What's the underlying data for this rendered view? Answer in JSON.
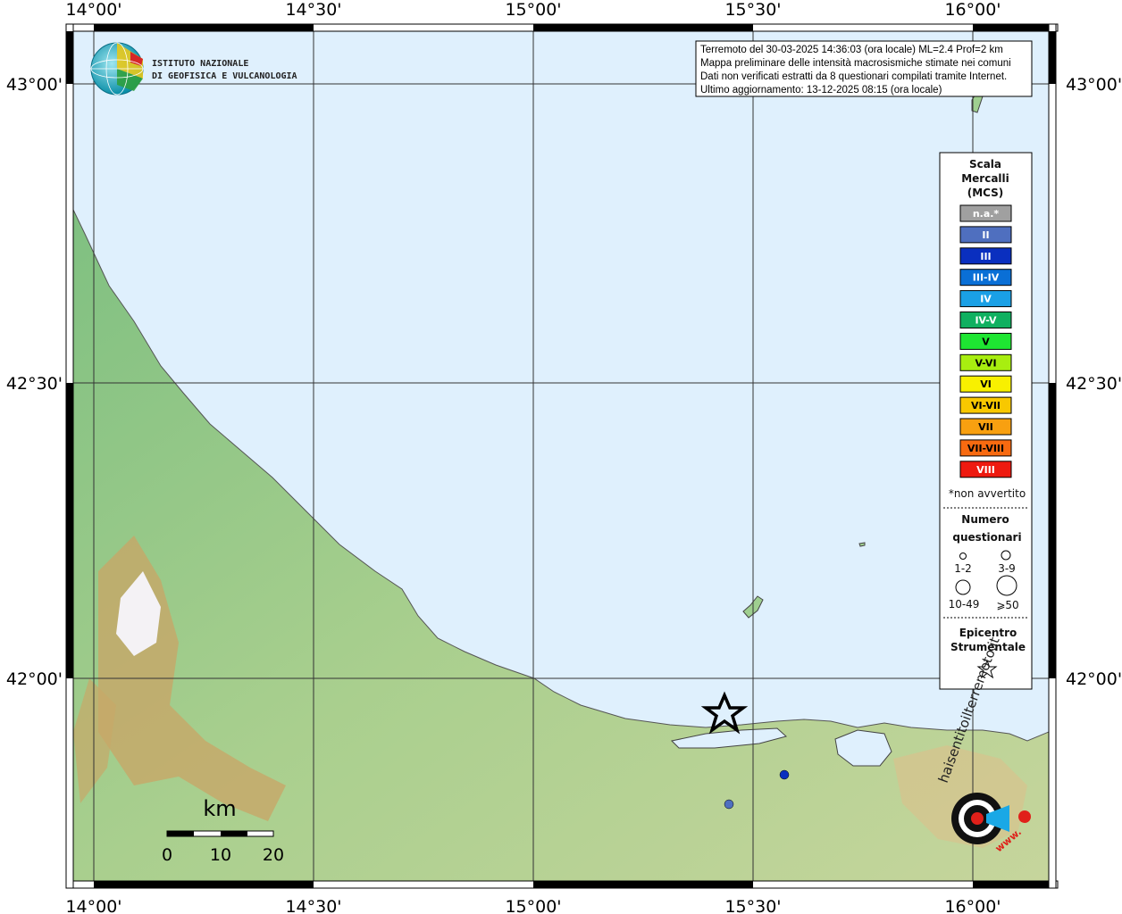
{
  "map": {
    "lon_ticks": [
      "14°00'",
      "14°30'",
      "15°00'",
      "15°30'",
      "16°00'"
    ],
    "lat_ticks": [
      "43°00'",
      "42°30'",
      "42°00'"
    ],
    "colors": {
      "sea": "#dff0fd",
      "land_low": "#8fc98c",
      "land_mid": "#bfd69a",
      "land_high": "#c9a466",
      "peak": "#f4f2f5",
      "grid": "#333333"
    }
  },
  "logo": {
    "line1": "ISTITUTO NAZIONALE",
    "line2": "DI GEOFISICA E VULCANOLOGIA",
    "icon": "ingv-globe-icon"
  },
  "info_box": {
    "line1": "Terremoto del 30-03-2025 14:36:03 (ora locale) ML=2.4 Prof=2 km",
    "line2": "Mappa preliminare delle intensità macrosismiche stimate nei comuni",
    "line3": "Dati non verificati estratti da 8 questionari compilati tramite Internet.",
    "line4": "Ultimo aggiornamento: 13-12-2025 08:15 (ora locale)"
  },
  "legend": {
    "title1": "Scala",
    "title2": "Mercalli",
    "title3": "(MCS)",
    "scale": [
      {
        "label": "n.a.*",
        "color": "#a0a0a0",
        "text_color": "#ffffff"
      },
      {
        "label": "II",
        "color": "#4f6fbf",
        "text_color": "#ffffff"
      },
      {
        "label": "III",
        "color": "#0a2fbf",
        "text_color": "#ffffff"
      },
      {
        "label": "III-IV",
        "color": "#0a6fd6",
        "text_color": "#ffffff"
      },
      {
        "label": "IV",
        "color": "#1aa0e6",
        "text_color": "#ffffff"
      },
      {
        "label": "IV-V",
        "color": "#10b060",
        "text_color": "#ffffff"
      },
      {
        "label": "V",
        "color": "#1ee632",
        "text_color": "#000000"
      },
      {
        "label": "V-VI",
        "color": "#a8ee10",
        "text_color": "#000000"
      },
      {
        "label": "VI",
        "color": "#f8f000",
        "text_color": "#000000"
      },
      {
        "label": "VI-VII",
        "color": "#f8c800",
        "text_color": "#000000"
      },
      {
        "label": "VII",
        "color": "#f8a010",
        "text_color": "#000000"
      },
      {
        "label": "VII-VIII",
        "color": "#f86a10",
        "text_color": "#000000"
      },
      {
        "label": "VIII",
        "color": "#ee1a10",
        "text_color": "#ffffff"
      }
    ],
    "note": "*non avvertito",
    "count_title1": "Numero",
    "count_title2": "questionari",
    "counts": [
      "1-2",
      "3-9",
      "10-49",
      "⩾50"
    ],
    "epi_title1": "Epicentro",
    "epi_title2": "Strumentale",
    "epi_icon": "star-icon"
  },
  "markers": [
    {
      "name": "epicenter-star-icon",
      "intensity": "epicentro"
    },
    {
      "name": "intensity-point",
      "intensity": "III",
      "color": "#0a2fbf"
    },
    {
      "name": "intensity-point",
      "intensity": "II",
      "color": "#4f6fbf"
    }
  ],
  "scale_bar": {
    "unit": "km",
    "labels": [
      "0",
      "10",
      "20"
    ]
  },
  "hsit_logo": {
    "text": "haisentitoilterremoto.it",
    "url_text": "www.",
    "icon": "hsit-target-icon"
  }
}
